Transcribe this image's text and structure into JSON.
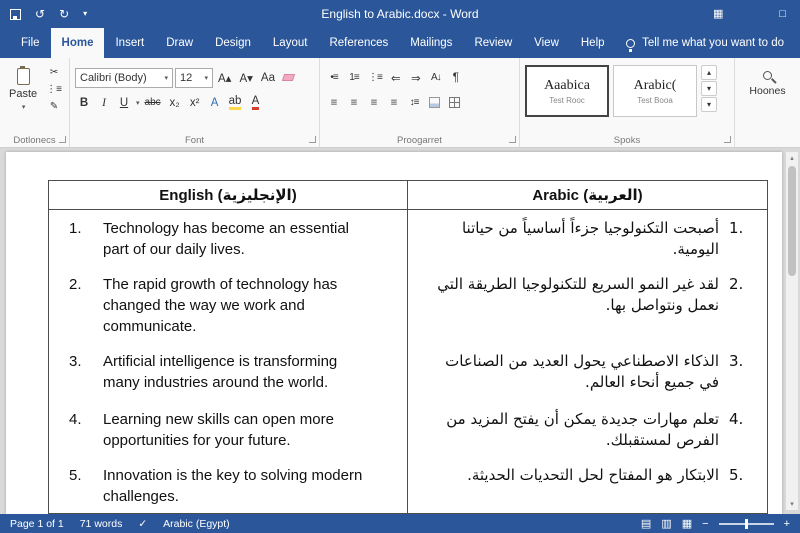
{
  "titlebar": {
    "title": "English to Arabic.docx - Word"
  },
  "tabs": [
    "File",
    "Home",
    "Insert",
    "Draw",
    "Design",
    "Layout",
    "References",
    "Mailings",
    "Review",
    "View",
    "Help"
  ],
  "tell_me": "Tell me what you want to do",
  "ribbon": {
    "clipboard": {
      "paste_label": "Paste",
      "group_label": "Dotlonecs"
    },
    "font": {
      "font_name": "Calibri (Body)",
      "font_size": "12",
      "group_label": "Font"
    },
    "paragraph": {
      "group_label": "Proogarret"
    },
    "styles": {
      "style1_title": "Aaabica",
      "style1_sub": "Test Rooc",
      "style2_title": "Arabic(",
      "style2_sub": "Test Booa",
      "group_label": "Spoks"
    },
    "editing": {
      "find_label": "Hoones"
    }
  },
  "icons": {
    "undo": "↺",
    "redo": "↻",
    "more": "▾",
    "dropdown": "▾",
    "cut": "✂",
    "painter": "✎",
    "grow_font": "A▴",
    "shrink_font": "A▾",
    "change_case": "Aa",
    "bold": "B",
    "italic": "I",
    "underline": "U",
    "strikethrough": "abc",
    "subscript": "x₂",
    "superscript": "x²",
    "text_effects": "A",
    "highlight": "ab",
    "font_color": "A",
    "bullets": "•≡",
    "numbering": "1≡",
    "multilevel": "⋮≡",
    "outdent": "⇐",
    "indent": "⇒",
    "sort": "A↓",
    "pilcrow": "¶",
    "align": "≡",
    "line_spacing": "↕≡",
    "scroll_up": "▴",
    "scroll_down": "▾",
    "grid": "▦",
    "restore": "□",
    "view_read": "▤",
    "view_print": "▥",
    "view_web": "▦",
    "zoom_out": "−",
    "zoom_in": "+",
    "check": "✓"
  },
  "document": {
    "headers": {
      "english": "English (الإنجليزية)",
      "arabic": "Arabic (العربية)"
    },
    "rows": [
      {
        "num": "1.",
        "en": "Technology has become an essential part of our daily lives.",
        "ar": "أصبحت التكنولوجيا جزءاً أساسياً من حياتنا اليومية."
      },
      {
        "num": "2.",
        "en": "The rapid growth of technology has changed the way we work and communicate.",
        "ar": "لقد غير النمو السريع للتكنولوجيا الطريقة التي نعمل ونتواصل بها."
      },
      {
        "num": "3.",
        "en": "Artificial intelligence is transforming many industries around the world.",
        "ar": "الذكاء الاصطناعي يحول العديد من الصناعات في جميع أنحاء العالم."
      },
      {
        "num": "4.",
        "en": "Learning new skills can open more opportunities for your future.",
        "ar": "تعلم مهارات جديدة يمكن أن يفتح المزيد من الفرص لمستقبلك."
      },
      {
        "num": "5.",
        "en": "Innovation is the key to solving modern challenges.",
        "ar": "الابتكار هو المفتاح لحل التحديات الحديثة."
      }
    ]
  },
  "statusbar": {
    "page_info": "Page 1 of 1",
    "word_count": "71 words",
    "language": "Arabic (Egypt)"
  }
}
